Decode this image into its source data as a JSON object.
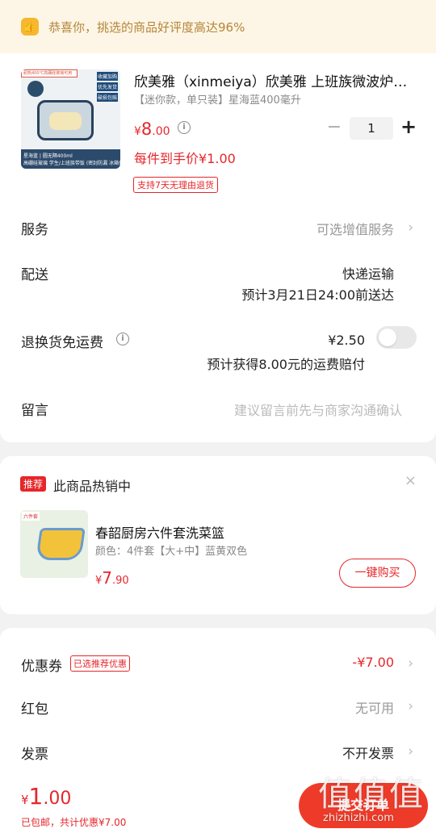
{
  "banner": {
    "icon": "thumbs-up-icon",
    "text": "恭喜你，挑选的商品好评度高达96%"
  },
  "product": {
    "title": "欣美雅（xinmeiya）欣美雅 上班族微波炉加热饭盒",
    "spec": "【迷你款，单只装】星海蓝400毫升",
    "price_symbol": "¥",
    "price_int": "8",
    "price_dec": ".00",
    "final_price": "每件到手价¥1.00",
    "tag": "支持7天无理由退货",
    "quantity": "1",
    "minus": "−",
    "plus": "+",
    "image_texts": {
      "top": "耐热400℃高硼硅玻璃可用",
      "badges": [
        "收藏加购",
        "优先发货",
        "破损包赔"
      ],
      "bottom1": "星海蓝 | 圆无隔400ml",
      "bottom2": "高硼硅玻璃 学生/上班族带饭 (密封防漏 冰箱保鲜)"
    }
  },
  "rows": {
    "service_label": "服务",
    "service_value": "可选增值服务",
    "delivery_label": "配送",
    "delivery_value": "快递运输",
    "delivery_eta": "预计3月21日24:00前送达",
    "return_label": "退换货免运费",
    "return_price": "¥2.50",
    "return_note": "预计获得8.00元的运费赔付",
    "note_label": "留言",
    "note_placeholder": "建议留言前先与商家沟通确认"
  },
  "recommend": {
    "tag": "推荐",
    "title": "此商品热销中",
    "close": "×",
    "image_label": "六件套",
    "name": "春韶厨房六件套洗菜篮",
    "spec": "颜色：4件套【大+中】蓝黄双色",
    "price_symbol": "¥",
    "price_int": "7",
    "price_dec": ".90",
    "button": "一键购买"
  },
  "discounts": {
    "coupon_label": "优惠券",
    "coupon_badge": "已选推荐优惠",
    "coupon_value": "-¥7.00",
    "redpacket_label": "红包",
    "redpacket_value": "无可用",
    "invoice_label": "发票",
    "invoice_value": "不开发票"
  },
  "footer": {
    "total_symbol": "¥",
    "total_int": "1",
    "total_dec": ".00",
    "sub": "已包邮，共计优惠¥7.00",
    "submit": "提交订单"
  },
  "watermark": {
    "text": "值值值",
    "url": "zhizhizhi.com"
  },
  "colors": {
    "accent": "#e6262b",
    "banner_bg": "#fdf6e6",
    "banner_text": "#b5853a"
  }
}
